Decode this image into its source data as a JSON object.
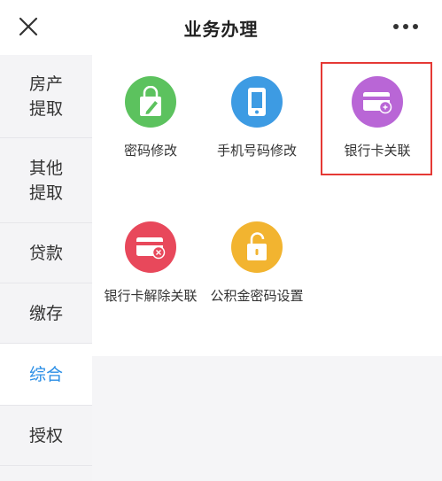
{
  "header": {
    "title": "业务办理",
    "close_icon": "close-icon",
    "more_icon": "more-icon"
  },
  "sidebar": {
    "items": [
      {
        "label": "房产\n提取",
        "active": false
      },
      {
        "label": "其他\n提取",
        "active": false
      },
      {
        "label": "贷款",
        "active": false
      },
      {
        "label": "缴存",
        "active": false
      },
      {
        "label": "综合",
        "active": true
      },
      {
        "label": "授权",
        "active": false
      }
    ]
  },
  "tiles": [
    {
      "label": "密码修改",
      "icon": "lock-edit-icon",
      "color": "#5cc25e"
    },
    {
      "label": "手机号码修改",
      "icon": "phone-icon",
      "color": "#3d9be3"
    },
    {
      "label": "银行卡关联",
      "icon": "bank-card-link-icon",
      "color": "#b966d6",
      "highlighted": true
    },
    {
      "label": "银行卡解除关联",
      "icon": "bank-card-unlink-icon",
      "color": "#e8485b"
    },
    {
      "label": "公积金密码设置",
      "icon": "unlock-icon",
      "color": "#f2b430"
    }
  ],
  "colors": {
    "accent": "#2a8ee6",
    "highlight_border": "#e53935",
    "sidebar_bg": "#f4f4f6"
  }
}
